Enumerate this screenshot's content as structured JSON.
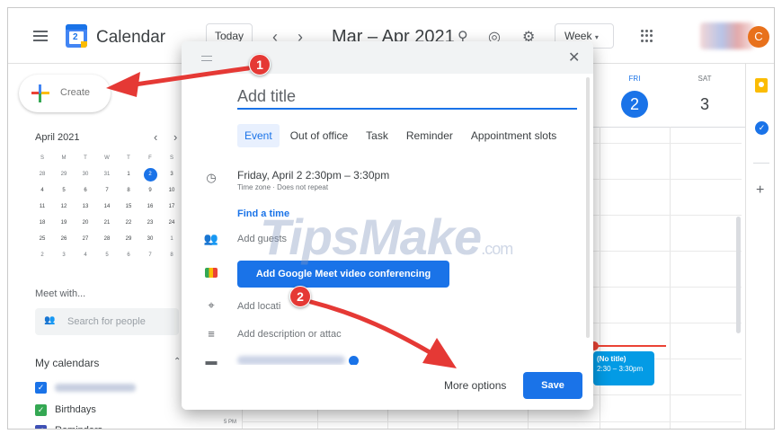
{
  "header": {
    "app_title": "Calendar",
    "logo_day": "2",
    "today_label": "Today",
    "date_range": "Mar – Apr 2021",
    "view_label": "Week",
    "avatar_letter": "C",
    "icons": [
      "menu-icon",
      "calendar-logo-icon",
      "chevron-left-icon",
      "chevron-right-icon",
      "search-icon",
      "help-icon",
      "settings-icon",
      "apps-icon"
    ]
  },
  "sidebar": {
    "create_label": "Create",
    "mini_calendar": {
      "title": "April 2021",
      "weekdays": [
        "S",
        "M",
        "T",
        "W",
        "T",
        "F",
        "S"
      ],
      "weeks": [
        [
          "28",
          "29",
          "30",
          "31",
          "1",
          "2",
          "3"
        ],
        [
          "4",
          "5",
          "6",
          "7",
          "8",
          "9",
          "10"
        ],
        [
          "11",
          "12",
          "13",
          "14",
          "15",
          "16",
          "17"
        ],
        [
          "18",
          "19",
          "20",
          "21",
          "22",
          "23",
          "24"
        ],
        [
          "25",
          "26",
          "27",
          "28",
          "29",
          "30",
          "1"
        ],
        [
          "2",
          "3",
          "4",
          "5",
          "6",
          "7",
          "8"
        ]
      ],
      "selected": "2"
    },
    "meet_with": "Meet with...",
    "search_people_placeholder": "Search for people",
    "my_calendars_label": "My calendars",
    "calendars": [
      {
        "label": "",
        "color": "#1a73e8"
      },
      {
        "label": "Birthdays",
        "color": "#34a853"
      },
      {
        "label": "Reminders",
        "color": "#3f51b5"
      }
    ]
  },
  "week": {
    "days": [
      {
        "name": "FRI",
        "num": "2",
        "today": true
      },
      {
        "name": "SAT",
        "num": "3",
        "today": false
      }
    ],
    "time_label": "5 PM",
    "event": {
      "title": "(No title)",
      "time": "2:30 – 3:30pm"
    }
  },
  "dialog": {
    "title_placeholder": "Add title",
    "tabs": [
      "Event",
      "Out of office",
      "Task",
      "Reminder",
      "Appointment slots"
    ],
    "active_tab": "Event",
    "datetime": "Friday, April 2   2:30pm  –  3:30pm",
    "timezone": "Time zone · Does not repeat",
    "find_time": "Find a time",
    "add_guests": "Add guests",
    "meet_button": "Add Google Meet video conferencing",
    "add_location": "Add locati",
    "add_description": "Add description or attac",
    "more_options": "More options",
    "save": "Save"
  },
  "watermark": {
    "main": "TipsMake",
    "suffix": ".com"
  },
  "annotations": {
    "badge1": "1",
    "badge2": "2",
    "color": "#e53935"
  }
}
